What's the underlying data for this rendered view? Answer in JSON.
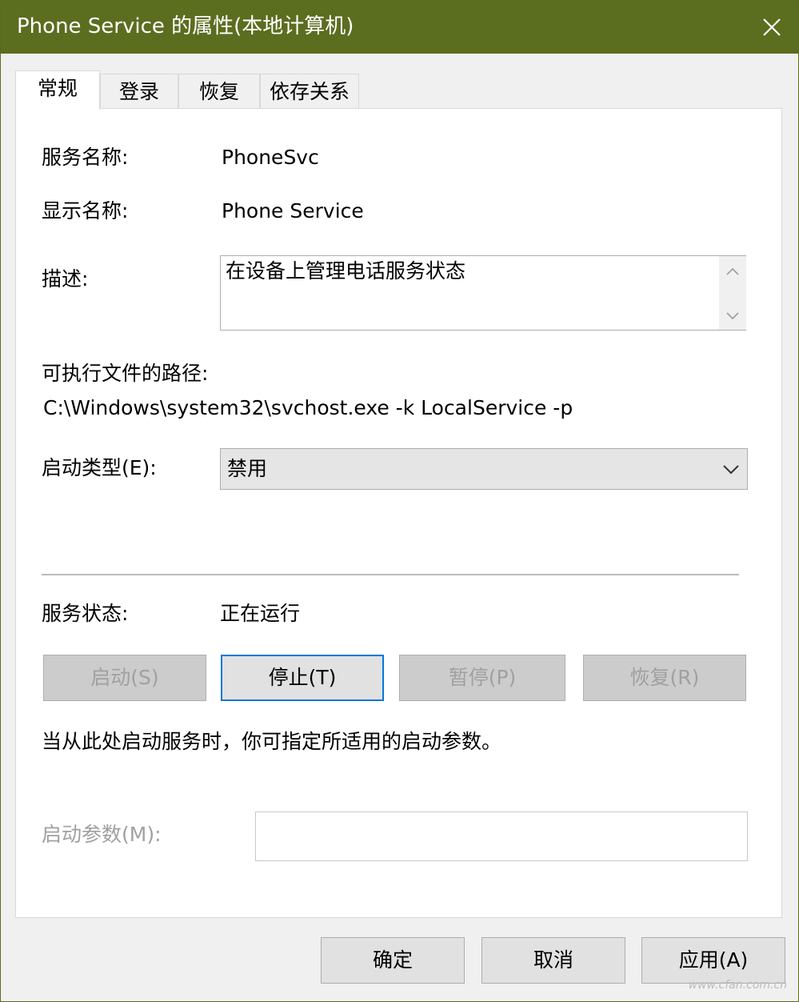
{
  "window": {
    "title": "Phone Service 的属性(本地计算机)"
  },
  "tabs": [
    {
      "label": "常规",
      "active": true
    },
    {
      "label": "登录",
      "active": false
    },
    {
      "label": "恢复",
      "active": false
    },
    {
      "label": "依存关系",
      "active": false
    }
  ],
  "general": {
    "service_name_label": "服务名称:",
    "service_name": "PhoneSvc",
    "display_name_label": "显示名称:",
    "display_name": "Phone Service",
    "description_label": "描述:",
    "description": "在设备上管理电话服务状态",
    "path_label": "可执行文件的路径:",
    "path": "C:\\Windows\\system32\\svchost.exe -k LocalService -p",
    "startup_type_label": "启动类型(E):",
    "startup_type": "禁用",
    "status_label": "服务状态:",
    "status": "正在运行",
    "buttons": {
      "start": "启动(S)",
      "stop": "停止(T)",
      "pause": "暂停(P)",
      "resume": "恢复(R)"
    },
    "hint": "当从此处启动服务时，你可指定所适用的启动参数。",
    "params_label": "启动参数(M):",
    "params_value": ""
  },
  "footer": {
    "ok": "确定",
    "cancel": "取消",
    "apply": "应用(A)"
  },
  "watermark": "www.cfan.com.cn",
  "colors": {
    "titlebar": "#5b6d1f",
    "focus_border": "#0078d7"
  }
}
